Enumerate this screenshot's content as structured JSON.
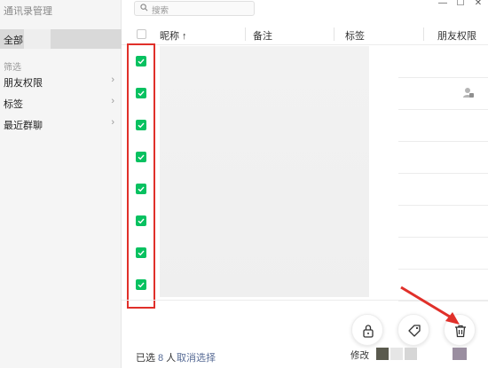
{
  "window": {
    "title": "通讯录管理"
  },
  "sidebar": {
    "all_label": "全部",
    "filter_section": "筛选",
    "items": [
      {
        "label": "朋友权限"
      },
      {
        "label": "标签"
      },
      {
        "label": "最近群聊"
      }
    ]
  },
  "search": {
    "placeholder": "搜索"
  },
  "table": {
    "columns": [
      {
        "label": "昵称 ↑"
      },
      {
        "label": "备注"
      },
      {
        "label": "标签"
      },
      {
        "label": "朋友权限"
      }
    ],
    "rows": [
      {
        "checked": true
      },
      {
        "checked": true
      },
      {
        "checked": true
      },
      {
        "checked": true
      },
      {
        "checked": true
      },
      {
        "checked": true
      },
      {
        "checked": true
      },
      {
        "checked": true
      }
    ]
  },
  "footer": {
    "selected_prefix": "已选",
    "selected_count": "8",
    "selected_unit": "人",
    "cancel_label": "取消选择",
    "modify_label": "修改",
    "actions": [
      {
        "name": "permission",
        "icon": "lock-icon"
      },
      {
        "name": "tag",
        "icon": "tag-icon"
      },
      {
        "name": "delete",
        "icon": "trash-icon"
      }
    ]
  },
  "colors": {
    "checkbox": "#07c160",
    "link": "#576b95",
    "highlight": "#e0302a"
  }
}
